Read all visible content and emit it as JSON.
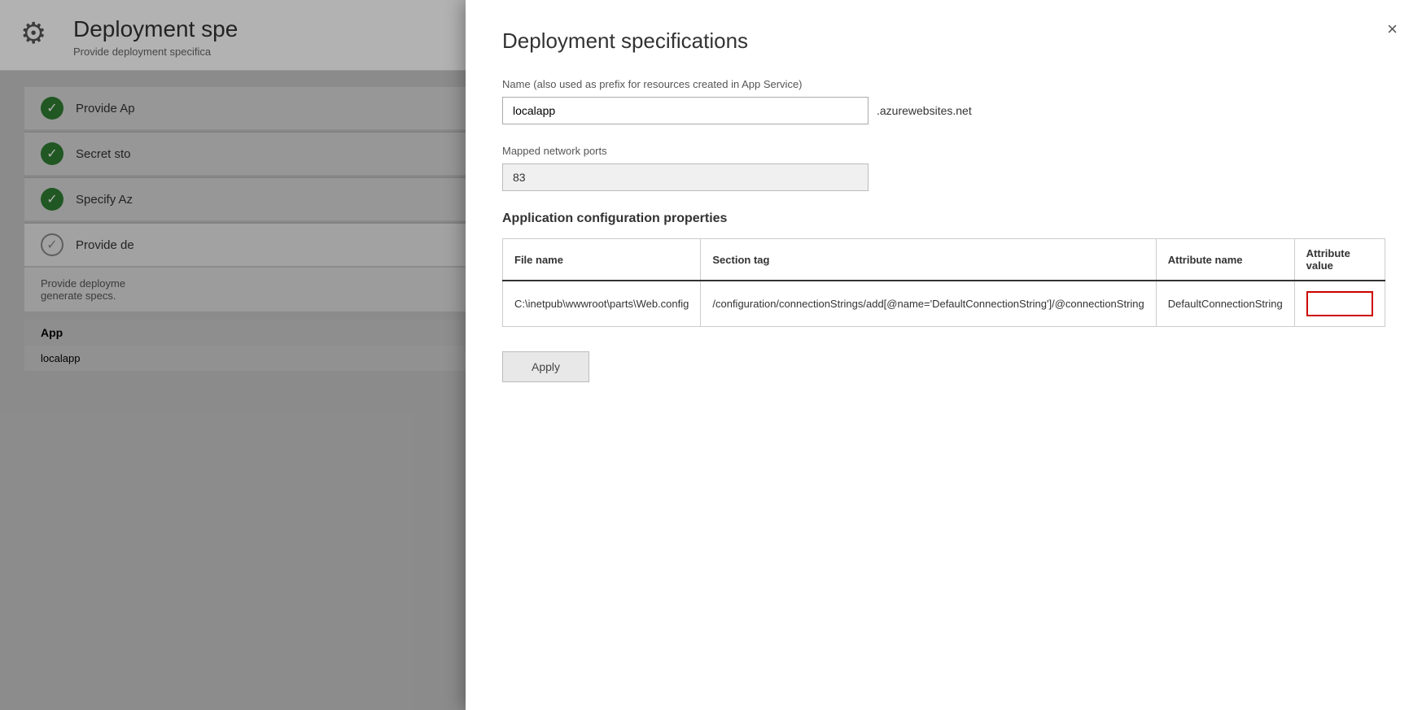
{
  "background": {
    "gear_icon": "⚙",
    "title": "Deployment spe",
    "subtitle": "Provide deployment specifica",
    "steps": [
      {
        "id": "step1",
        "label": "Provide Ap",
        "status": "complete"
      },
      {
        "id": "step2",
        "label": "Secret sto",
        "status": "complete"
      },
      {
        "id": "step3",
        "label": "Specify Az",
        "status": "complete"
      },
      {
        "id": "step4",
        "label": "Provide de",
        "status": "outline"
      }
    ],
    "step4_description1": "Provide deployme",
    "step4_description2": "generate specs.",
    "table_header": "App",
    "table_row": "localapp"
  },
  "modal": {
    "title": "Deployment specifications",
    "close_label": "×",
    "name_label": "Name (also used as prefix for resources created in App Service)",
    "name_value": "localapp",
    "domain_suffix": ".azurewebsites.net",
    "ports_label": "Mapped network ports",
    "ports_value": "83",
    "section_title": "Application configuration properties",
    "table": {
      "columns": [
        "File name",
        "Section tag",
        "Attribute name",
        "Attribute value"
      ],
      "rows": [
        {
          "file_name": "C:\\inetpub\\wwwroot\\parts\\Web.config",
          "section_tag": "/configuration/connectionStrings/add[@name='DefaultConnectionString']/@connectionString",
          "attribute_name": "DefaultConnectionString",
          "attribute_value": ""
        }
      ]
    },
    "apply_label": "Apply"
  }
}
